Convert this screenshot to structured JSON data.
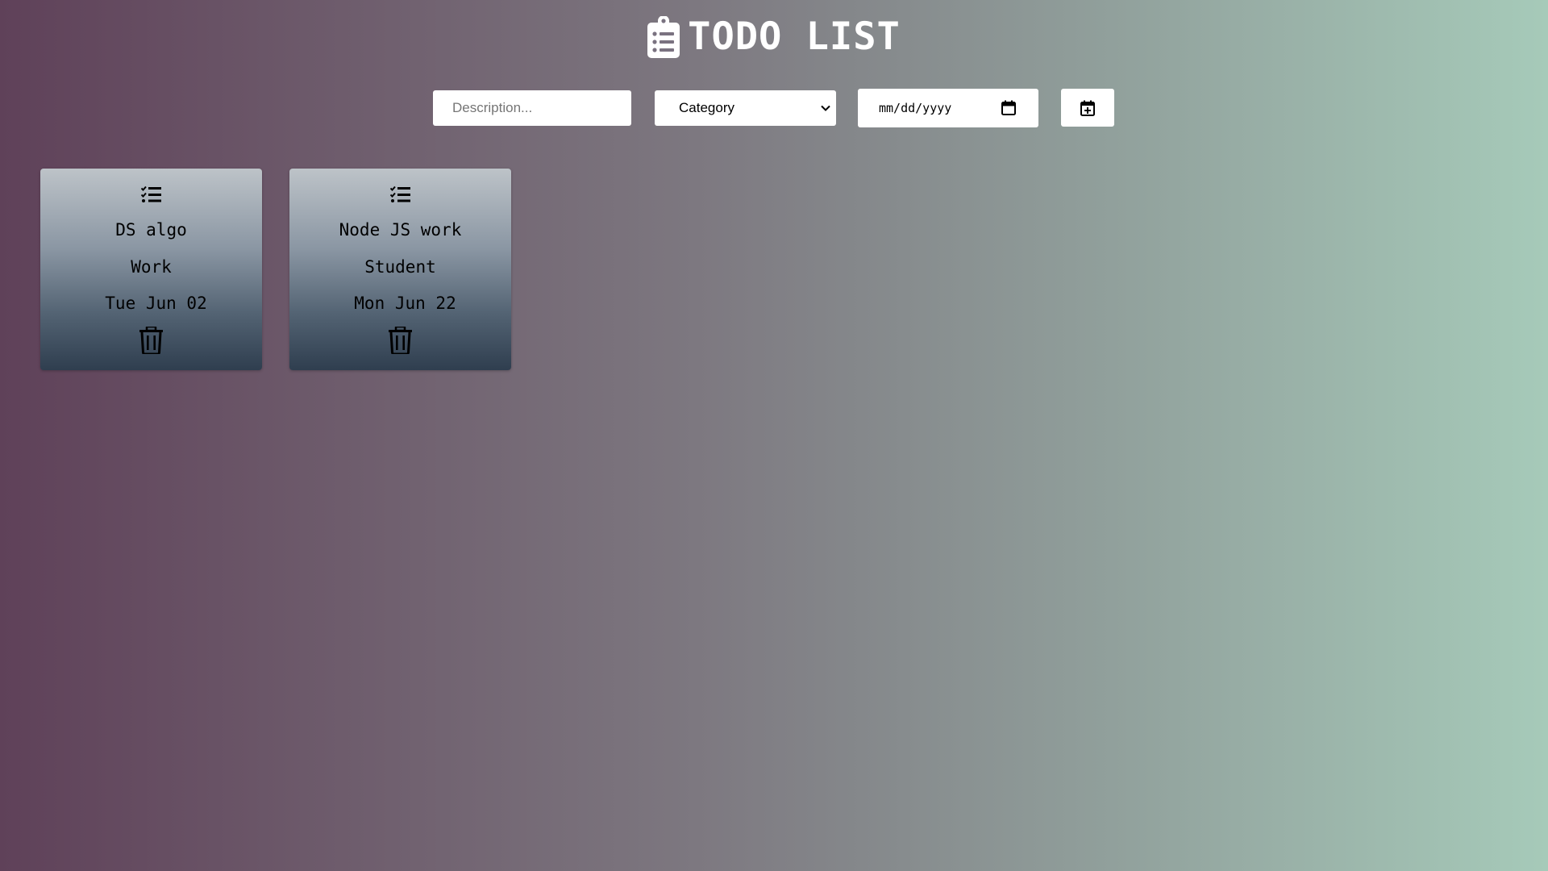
{
  "header": {
    "title": "TODO LIST",
    "icon": "clipboard-list-icon"
  },
  "form": {
    "description": {
      "placeholder": "Description...",
      "value": ""
    },
    "category": {
      "selected": "Category"
    },
    "date": {
      "value": "mm/dd/yyyy"
    },
    "add_button": {
      "icon": "calendar-plus-icon"
    }
  },
  "todos": [
    {
      "description": "DS algo",
      "category": "Work",
      "date": "Tue Jun 02"
    },
    {
      "description": "Node JS work",
      "category": "Student",
      "date": "Mon Jun 22"
    }
  ],
  "colors": {
    "gradient_left": "#5f4159",
    "gradient_right": "#a6cab9",
    "card_top": "#bdc3c8",
    "card_bottom": "#2f3e4f",
    "title_text": "#ffffff"
  }
}
